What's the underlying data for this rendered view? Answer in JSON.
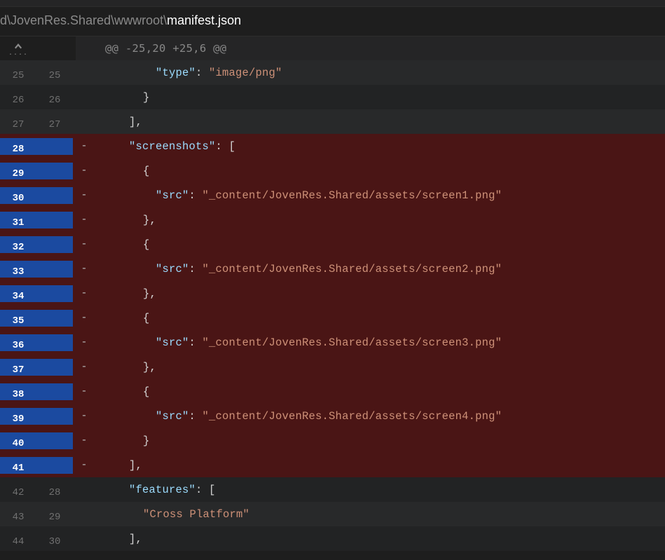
{
  "file": {
    "path_prefix": "d\\JovenRes.Shared\\wwwroot\\",
    "filename": "manifest.json"
  },
  "hunk_header": "@@ -25,20 +25,6 @@",
  "lines": [
    {
      "type": "ctx",
      "old": "25",
      "new": "25",
      "indent": "i4",
      "parts": [
        {
          "t": "key",
          "v": "\"type\""
        },
        {
          "t": "punc",
          "v": ": "
        },
        {
          "t": "str",
          "v": "\"image/png\""
        }
      ]
    },
    {
      "type": "ctx",
      "old": "26",
      "new": "26",
      "indent": "i3",
      "parts": [
        {
          "t": "punc",
          "v": "}"
        }
      ]
    },
    {
      "type": "ctx",
      "old": "27",
      "new": "27",
      "indent": "i2",
      "parts": [
        {
          "t": "punc",
          "v": "],"
        }
      ]
    },
    {
      "type": "del",
      "old": "28",
      "new": "",
      "marker": "-",
      "indent": "i2",
      "parts": [
        {
          "t": "key",
          "v": "\"screenshots\""
        },
        {
          "t": "punc",
          "v": ": ["
        }
      ]
    },
    {
      "type": "del",
      "old": "29",
      "new": "",
      "marker": "-",
      "indent": "i3",
      "parts": [
        {
          "t": "punc",
          "v": "{"
        }
      ]
    },
    {
      "type": "del",
      "old": "30",
      "new": "",
      "marker": "-",
      "indent": "i4",
      "parts": [
        {
          "t": "key",
          "v": "\"src\""
        },
        {
          "t": "punc",
          "v": ": "
        },
        {
          "t": "str",
          "v": "\"_content/JovenRes.Shared/assets/screen1.png\""
        }
      ]
    },
    {
      "type": "del",
      "old": "31",
      "new": "",
      "marker": "-",
      "indent": "i3",
      "parts": [
        {
          "t": "punc",
          "v": "},"
        }
      ]
    },
    {
      "type": "del",
      "old": "32",
      "new": "",
      "marker": "-",
      "indent": "i3",
      "parts": [
        {
          "t": "punc",
          "v": "{"
        }
      ]
    },
    {
      "type": "del",
      "old": "33",
      "new": "",
      "marker": "-",
      "indent": "i4",
      "parts": [
        {
          "t": "key",
          "v": "\"src\""
        },
        {
          "t": "punc",
          "v": ": "
        },
        {
          "t": "str",
          "v": "\"_content/JovenRes.Shared/assets/screen2.png\""
        }
      ]
    },
    {
      "type": "del",
      "old": "34",
      "new": "",
      "marker": "-",
      "indent": "i3",
      "parts": [
        {
          "t": "punc",
          "v": "},"
        }
      ]
    },
    {
      "type": "del",
      "old": "35",
      "new": "",
      "marker": "-",
      "indent": "i3",
      "parts": [
        {
          "t": "punc",
          "v": "{"
        }
      ]
    },
    {
      "type": "del",
      "old": "36",
      "new": "",
      "marker": "-",
      "indent": "i4",
      "parts": [
        {
          "t": "key",
          "v": "\"src\""
        },
        {
          "t": "punc",
          "v": ": "
        },
        {
          "t": "str",
          "v": "\"_content/JovenRes.Shared/assets/screen3.png\""
        }
      ]
    },
    {
      "type": "del",
      "old": "37",
      "new": "",
      "marker": "-",
      "indent": "i3",
      "parts": [
        {
          "t": "punc",
          "v": "},"
        }
      ]
    },
    {
      "type": "del",
      "old": "38",
      "new": "",
      "marker": "-",
      "indent": "i3",
      "parts": [
        {
          "t": "punc",
          "v": "{"
        }
      ]
    },
    {
      "type": "del",
      "old": "39",
      "new": "",
      "marker": "-",
      "indent": "i4",
      "parts": [
        {
          "t": "key",
          "v": "\"src\""
        },
        {
          "t": "punc",
          "v": ": "
        },
        {
          "t": "str",
          "v": "\"_content/JovenRes.Shared/assets/screen4.png\""
        }
      ]
    },
    {
      "type": "del",
      "old": "40",
      "new": "",
      "marker": "-",
      "indent": "i3",
      "parts": [
        {
          "t": "punc",
          "v": "}"
        }
      ]
    },
    {
      "type": "del",
      "old": "41",
      "new": "",
      "marker": "-",
      "indent": "i2",
      "parts": [
        {
          "t": "punc",
          "v": "],"
        }
      ]
    },
    {
      "type": "ctx",
      "old": "42",
      "new": "28",
      "indent": "i2",
      "parts": [
        {
          "t": "key",
          "v": "\"features\""
        },
        {
          "t": "punc",
          "v": ": ["
        }
      ]
    },
    {
      "type": "ctx",
      "old": "43",
      "new": "29",
      "indent": "i3",
      "parts": [
        {
          "t": "str",
          "v": "\"Cross Platform\""
        }
      ]
    },
    {
      "type": "ctx",
      "old": "44",
      "new": "30",
      "indent": "i2",
      "parts": [
        {
          "t": "punc",
          "v": "],"
        }
      ]
    }
  ]
}
